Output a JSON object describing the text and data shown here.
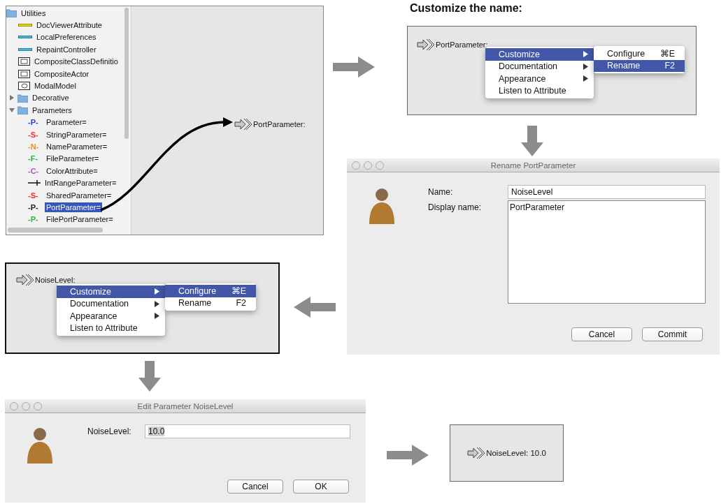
{
  "library_panel": {
    "tree": [
      {
        "label": "Utilities",
        "kind": "folder",
        "selected": false,
        "children": [
          {
            "label": "DocViewerAttribute",
            "kind": "bar",
            "color": "#e8dc00",
            "selected": false
          },
          {
            "label": "LocalPreferences",
            "kind": "bar",
            "color": "#40bce0",
            "selected": false
          },
          {
            "label": "RepaintController",
            "kind": "bar",
            "color": "#40bce0",
            "selected": false
          },
          {
            "label": "CompositeClassDefinitio",
            "kind": "composite",
            "selected": false
          },
          {
            "label": "CompositeActor",
            "kind": "composite",
            "selected": false
          },
          {
            "label": "ModalModel",
            "kind": "modal",
            "selected": false
          }
        ]
      },
      {
        "label": "Decorative",
        "kind": "folder",
        "expanded": false,
        "selected": false
      },
      {
        "label": "Parameters",
        "kind": "folder",
        "expanded": true,
        "selected": false,
        "children": [
          {
            "label": "Parameter=",
            "kind": "param",
            "glyph": "-P-",
            "color": "#2a3fd0",
            "selected": false
          },
          {
            "label": "StringParameter=",
            "kind": "param",
            "glyph": "-S-",
            "color": "#e83030",
            "selected": false
          },
          {
            "label": "NameParameter=",
            "kind": "param",
            "glyph": "-N-",
            "color": "#f08c30",
            "selected": false
          },
          {
            "label": "FileParameter=",
            "kind": "param",
            "glyph": "-F-",
            "color": "#30b040",
            "selected": false
          },
          {
            "label": "ColorAttribute=",
            "kind": "param",
            "glyph": "-C-",
            "color": "#b050c0",
            "selected": false
          },
          {
            "label": "IntRangeParameter=",
            "kind": "range",
            "selected": false
          },
          {
            "label": "SharedParameter=",
            "kind": "param",
            "glyph": "-S-",
            "color": "#e83030",
            "selected": false
          },
          {
            "label": "PortParameter=",
            "kind": "param",
            "glyph": "-P-",
            "color": "#222222",
            "selected": true
          },
          {
            "label": "FilePortParameter=",
            "kind": "param",
            "glyph": "-P-",
            "color": "#30b040",
            "selected": false
          }
        ]
      }
    ],
    "canvas_label": "PortParameter:"
  },
  "heading": "Customize the name:",
  "rename_menu_panel": {
    "port_label": "PortParameter:",
    "menu": [
      {
        "label": "Customize",
        "has_submenu": true,
        "selected": true
      },
      {
        "label": "Documentation",
        "has_submenu": true,
        "selected": false
      },
      {
        "label": "Appearance",
        "has_submenu": true,
        "selected": false
      },
      {
        "label": "Listen to Attribute",
        "has_submenu": false,
        "selected": false
      }
    ],
    "submenu": [
      {
        "label": "Configure",
        "shortcut": "⌘E",
        "selected": false
      },
      {
        "label": "Rename",
        "shortcut": "F2",
        "selected": true
      }
    ]
  },
  "rename_dialog": {
    "title": "Rename PortParameter",
    "fields": [
      {
        "label": "Name:",
        "kind": "line",
        "value": "NoiseLevel"
      },
      {
        "label": "Display name:",
        "kind": "area",
        "value": "PortParameter"
      }
    ],
    "buttons": [
      "Cancel",
      "Commit"
    ]
  },
  "configure_menu_panel": {
    "port_label": "NoiseLevel:",
    "menu": [
      {
        "label": "Customize",
        "has_submenu": true,
        "selected": true
      },
      {
        "label": "Documentation",
        "has_submenu": true,
        "selected": false
      },
      {
        "label": "Appearance",
        "has_submenu": true,
        "selected": false
      },
      {
        "label": "Listen to Attribute",
        "has_submenu": false,
        "selected": false
      }
    ],
    "submenu": [
      {
        "label": "Configure",
        "shortcut": "⌘E",
        "selected": true
      },
      {
        "label": "Rename",
        "shortcut": "F2",
        "selected": false
      }
    ]
  },
  "edit_dialog": {
    "title": "Edit Parameter NoiseLevel",
    "fields": [
      {
        "label": "NoiseLevel:",
        "kind": "line",
        "value": "10.0",
        "value_selected": true
      }
    ],
    "buttons": [
      "Cancel",
      "OK"
    ]
  },
  "result_panel": {
    "port_label": "NoiseLevel: 10.0"
  }
}
